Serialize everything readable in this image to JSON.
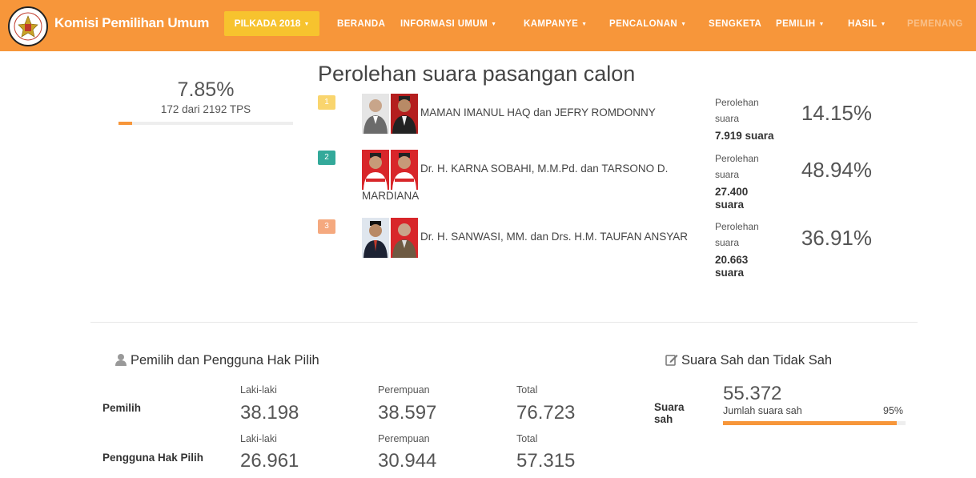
{
  "brand": {
    "name": "Komisi Pemilihan Umum",
    "logo_text": "KOMISI PEMILIHAN UMUM"
  },
  "nav": {
    "pilkada_label": "PILKADA 2018",
    "items": [
      "BERANDA",
      "INFORMASI UMUM",
      "KAMPANYE",
      "PENCALONAN",
      "SENGKETA",
      "PEMILIH",
      "HASIL",
      "PEMENANG"
    ]
  },
  "progress": {
    "percent_label": "7.85%",
    "subtitle": "172 dari 2192 TPS",
    "fraction": 0.0785
  },
  "results": {
    "title": "Perolehan suara pasangan calon",
    "vote_label": "Perolehan suara",
    "candidates": [
      {
        "number": "1",
        "name": "MAMAN IMANUL HAQ dan JEFRY ROMDONNY",
        "votes": "7.919 suara",
        "percent": "14.15%",
        "badge_color": "#f9d56e"
      },
      {
        "number": "2",
        "name": "Dr. H. KARNA SOBAHI, M.M.Pd. dan TARSONO D. MARDIANA",
        "votes": "27.400 suara",
        "percent": "48.94%",
        "badge_color": "#33a99a"
      },
      {
        "number": "3",
        "name": "Dr. H. SANWASI, MM. dan Drs. H.M. TAUFAN ANSYAR",
        "votes": "20.663 suara",
        "percent": "36.91%",
        "badge_color": "#f5a97f"
      }
    ]
  },
  "voters": {
    "title": "Pemilih dan Pengguna Hak Pilih",
    "rows": [
      {
        "label": "Pemilih",
        "male_label": "Laki-laki",
        "male": "38.198",
        "female_label": "Perempuan",
        "female": "38.597",
        "total_label": "Total",
        "total": "76.723"
      },
      {
        "label": "Pengguna Hak Pilih",
        "male_label": "Laki-laki",
        "male": "26.961",
        "female_label": "Perempuan",
        "female": "30.944",
        "total_label": "Total",
        "total": "57.315"
      }
    ]
  },
  "valid_votes": {
    "title": "Suara Sah dan Tidak Sah",
    "label": "Suara sah",
    "value": "55.372",
    "caption": "Jumlah suara sah",
    "percent_label": "95%",
    "fraction": 0.95
  },
  "colors": {
    "accent": "#f7963a",
    "pilkada_button": "#f7c32e"
  }
}
